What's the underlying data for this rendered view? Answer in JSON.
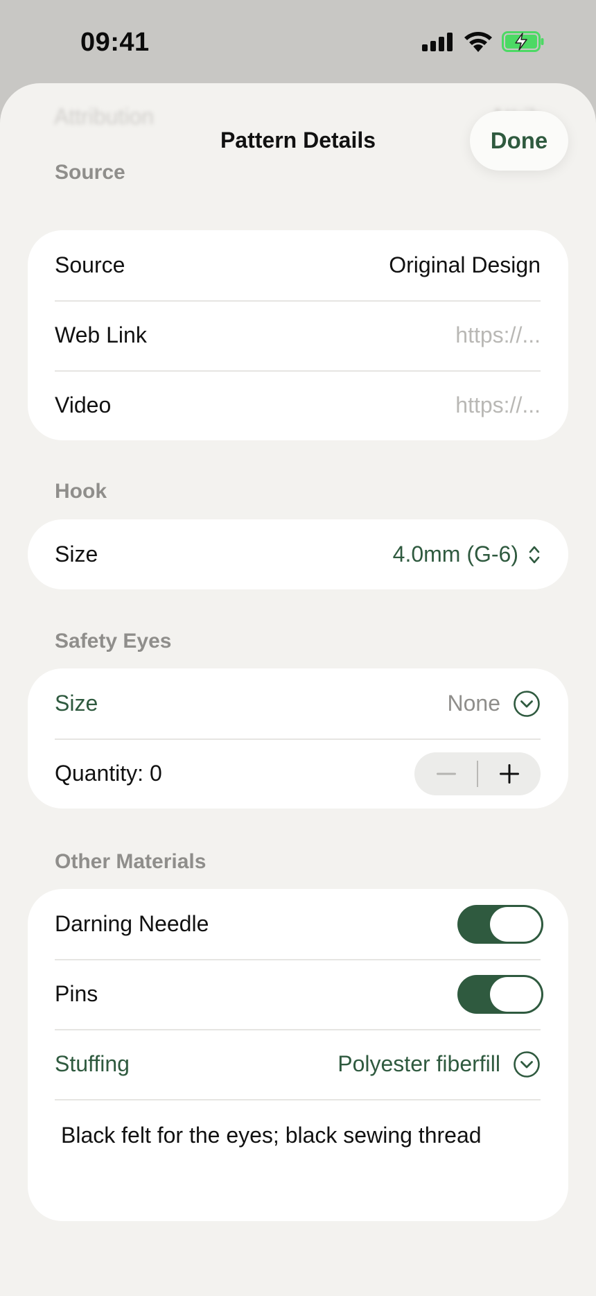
{
  "status_bar": {
    "time": "09:41",
    "icons": [
      "signal-icon",
      "wifi-icon",
      "battery-charging-icon"
    ],
    "battery_color": "#4cd964"
  },
  "background_ghost": {
    "left": "Attribution",
    "right": "Attrib"
  },
  "header": {
    "title": "Pattern Details",
    "done_label": "Done"
  },
  "sections": {
    "source": {
      "label": "Source",
      "rows": [
        {
          "label": "Source",
          "value": "Original Design"
        },
        {
          "label": "Web Link",
          "placeholder": "https://..."
        },
        {
          "label": "Video",
          "placeholder": "https://..."
        }
      ]
    },
    "hook": {
      "label": "Hook",
      "size_label": "Size",
      "size_value": "4.0mm (G-6)"
    },
    "safety_eyes": {
      "label": "Safety Eyes",
      "size_label": "Size",
      "size_value": "None",
      "quantity_label": "Quantity: 0",
      "quantity": 0
    },
    "other_materials": {
      "label": "Other Materials",
      "darning_needle_label": "Darning Needle",
      "darning_needle_on": true,
      "pins_label": "Pins",
      "pins_on": true,
      "stuffing_label": "Stuffing",
      "stuffing_value": "Polyester fiberfill",
      "notes": "Black felt for the eyes; black sewing thread"
    }
  },
  "colors": {
    "accent": "#2f5a3f",
    "background": "#f3f2ef",
    "card": "#ffffff",
    "secondary_text": "#8f8e8b"
  }
}
